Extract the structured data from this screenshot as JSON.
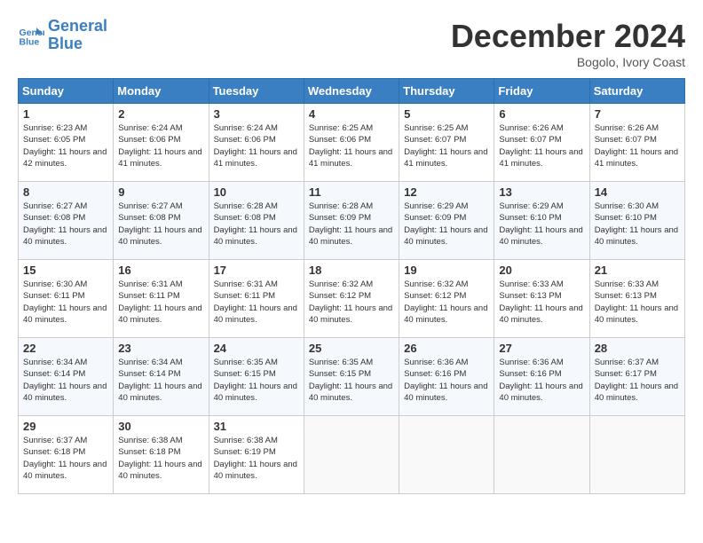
{
  "header": {
    "logo_line1": "General",
    "logo_line2": "Blue",
    "month_title": "December 2024",
    "location": "Bogolo, Ivory Coast"
  },
  "days_of_week": [
    "Sunday",
    "Monday",
    "Tuesday",
    "Wednesday",
    "Thursday",
    "Friday",
    "Saturday"
  ],
  "weeks": [
    [
      {
        "day": "1",
        "sunrise": "6:23 AM",
        "sunset": "6:05 PM",
        "daylight": "11 hours and 42 minutes"
      },
      {
        "day": "2",
        "sunrise": "6:24 AM",
        "sunset": "6:06 PM",
        "daylight": "11 hours and 41 minutes"
      },
      {
        "day": "3",
        "sunrise": "6:24 AM",
        "sunset": "6:06 PM",
        "daylight": "11 hours and 41 minutes"
      },
      {
        "day": "4",
        "sunrise": "6:25 AM",
        "sunset": "6:06 PM",
        "daylight": "11 hours and 41 minutes"
      },
      {
        "day": "5",
        "sunrise": "6:25 AM",
        "sunset": "6:07 PM",
        "daylight": "11 hours and 41 minutes"
      },
      {
        "day": "6",
        "sunrise": "6:26 AM",
        "sunset": "6:07 PM",
        "daylight": "11 hours and 41 minutes"
      },
      {
        "day": "7",
        "sunrise": "6:26 AM",
        "sunset": "6:07 PM",
        "daylight": "11 hours and 41 minutes"
      }
    ],
    [
      {
        "day": "8",
        "sunrise": "6:27 AM",
        "sunset": "6:08 PM",
        "daylight": "11 hours and 40 minutes"
      },
      {
        "day": "9",
        "sunrise": "6:27 AM",
        "sunset": "6:08 PM",
        "daylight": "11 hours and 40 minutes"
      },
      {
        "day": "10",
        "sunrise": "6:28 AM",
        "sunset": "6:08 PM",
        "daylight": "11 hours and 40 minutes"
      },
      {
        "day": "11",
        "sunrise": "6:28 AM",
        "sunset": "6:09 PM",
        "daylight": "11 hours and 40 minutes"
      },
      {
        "day": "12",
        "sunrise": "6:29 AM",
        "sunset": "6:09 PM",
        "daylight": "11 hours and 40 minutes"
      },
      {
        "day": "13",
        "sunrise": "6:29 AM",
        "sunset": "6:10 PM",
        "daylight": "11 hours and 40 minutes"
      },
      {
        "day": "14",
        "sunrise": "6:30 AM",
        "sunset": "6:10 PM",
        "daylight": "11 hours and 40 minutes"
      }
    ],
    [
      {
        "day": "15",
        "sunrise": "6:30 AM",
        "sunset": "6:11 PM",
        "daylight": "11 hours and 40 minutes"
      },
      {
        "day": "16",
        "sunrise": "6:31 AM",
        "sunset": "6:11 PM",
        "daylight": "11 hours and 40 minutes"
      },
      {
        "day": "17",
        "sunrise": "6:31 AM",
        "sunset": "6:11 PM",
        "daylight": "11 hours and 40 minutes"
      },
      {
        "day": "18",
        "sunrise": "6:32 AM",
        "sunset": "6:12 PM",
        "daylight": "11 hours and 40 minutes"
      },
      {
        "day": "19",
        "sunrise": "6:32 AM",
        "sunset": "6:12 PM",
        "daylight": "11 hours and 40 minutes"
      },
      {
        "day": "20",
        "sunrise": "6:33 AM",
        "sunset": "6:13 PM",
        "daylight": "11 hours and 40 minutes"
      },
      {
        "day": "21",
        "sunrise": "6:33 AM",
        "sunset": "6:13 PM",
        "daylight": "11 hours and 40 minutes"
      }
    ],
    [
      {
        "day": "22",
        "sunrise": "6:34 AM",
        "sunset": "6:14 PM",
        "daylight": "11 hours and 40 minutes"
      },
      {
        "day": "23",
        "sunrise": "6:34 AM",
        "sunset": "6:14 PM",
        "daylight": "11 hours and 40 minutes"
      },
      {
        "day": "24",
        "sunrise": "6:35 AM",
        "sunset": "6:15 PM",
        "daylight": "11 hours and 40 minutes"
      },
      {
        "day": "25",
        "sunrise": "6:35 AM",
        "sunset": "6:15 PM",
        "daylight": "11 hours and 40 minutes"
      },
      {
        "day": "26",
        "sunrise": "6:36 AM",
        "sunset": "6:16 PM",
        "daylight": "11 hours and 40 minutes"
      },
      {
        "day": "27",
        "sunrise": "6:36 AM",
        "sunset": "6:16 PM",
        "daylight": "11 hours and 40 minutes"
      },
      {
        "day": "28",
        "sunrise": "6:37 AM",
        "sunset": "6:17 PM",
        "daylight": "11 hours and 40 minutes"
      }
    ],
    [
      {
        "day": "29",
        "sunrise": "6:37 AM",
        "sunset": "6:18 PM",
        "daylight": "11 hours and 40 minutes"
      },
      {
        "day": "30",
        "sunrise": "6:38 AM",
        "sunset": "6:18 PM",
        "daylight": "11 hours and 40 minutes"
      },
      {
        "day": "31",
        "sunrise": "6:38 AM",
        "sunset": "6:19 PM",
        "daylight": "11 hours and 40 minutes"
      },
      null,
      null,
      null,
      null
    ]
  ]
}
